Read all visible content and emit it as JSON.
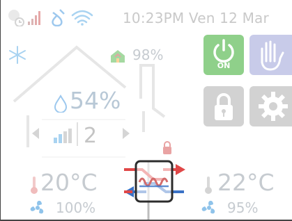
{
  "status_bar": {
    "clock": "10:23PM Ven 12 Mar",
    "icons": [
      "clock-icon",
      "signal-bars-icon",
      "water-drop-icon",
      "wifi-icon"
    ]
  },
  "house": {
    "outdoor_humidity": "98%",
    "indoor_humidity": "54%",
    "fan_speed": "2",
    "indoor_temp": "20°C",
    "outdoor_temp": "22°C",
    "supply_fan": "100%",
    "exhaust_fan": "95%"
  },
  "controls": {
    "power_label": "ON"
  },
  "colors": {
    "accent_green": "#8fd08a",
    "lilac": "#c8cbe9",
    "gray_tile": "#d2d2d2",
    "cold_blue": "#9dc8ee",
    "warm_red": "#e04848",
    "heat_blue": "#3a72c6"
  }
}
